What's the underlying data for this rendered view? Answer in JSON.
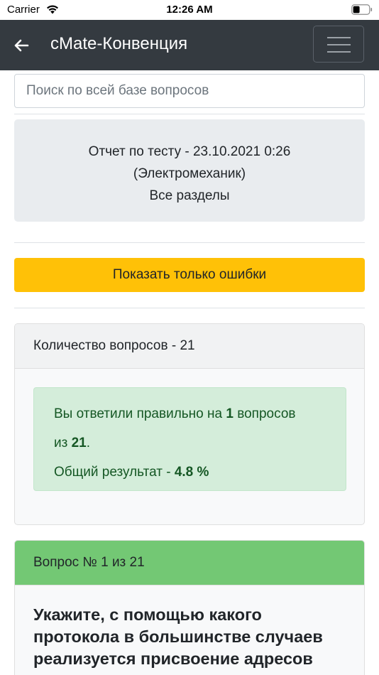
{
  "status_bar": {
    "carrier": "Carrier",
    "time": "12:26 AM",
    "wifi_icon": "wifi-icon",
    "battery_icon": "battery-icon"
  },
  "navbar": {
    "title": "cMate-Конвенция",
    "back_icon": "arrow-left-icon",
    "menu_icon": "hamburger-menu-icon",
    "bg_color": "#343a40"
  },
  "search": {
    "placeholder": "Поиск по всей базе вопросов"
  },
  "report": {
    "line1": "Отчет по тесту - 23.10.2021 0:26",
    "line2": "(Электромеханик)",
    "line3": "Все разделы"
  },
  "errors_button": {
    "label": "Показать только ошибки",
    "color": "#ffc107"
  },
  "summary_card": {
    "header": "Количество вопросов - 21",
    "result": {
      "text1": "Вы ответили правильно на ",
      "correct": "1",
      "text2": " вопросов",
      "text3": "из ",
      "total": "21",
      "text4": ".",
      "score_label": "Общий результат - ",
      "score": "4.8 %"
    }
  },
  "question_card": {
    "header": "Вопрос № 1 из 21",
    "header_color": "#73c874",
    "question_text": "Укажите, с помощью какого протокола в большинстве случаев реализуется присвоение адресов"
  }
}
